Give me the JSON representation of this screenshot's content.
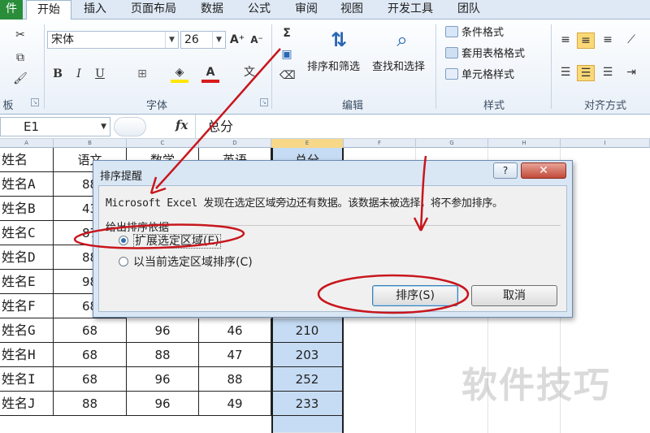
{
  "tabs": {
    "file": "件",
    "home": "开始",
    "insert": "插入",
    "page_layout": "页面布局",
    "data": "数据",
    "formulas": "公式",
    "review": "审阅",
    "view": "视图",
    "developer": "开发工具",
    "team": "团队"
  },
  "ribbon": {
    "clipboard_label": "板",
    "font_label": "字体",
    "font_name": "宋体",
    "font_size": "26",
    "edit_label": "编辑",
    "sort_filter": "排序和筛选",
    "find_select": "查找和选择",
    "styles_label": "样式",
    "conditional_format": "条件格式",
    "table_format": "套用表格格式",
    "cell_styles": "单元格样式",
    "align_label": "对齐方式"
  },
  "formula_bar": {
    "name_box": "E1",
    "fx": "fx",
    "content": "总分"
  },
  "sheet": {
    "columns": [
      "A",
      "B",
      "C",
      "D",
      "E",
      "F",
      "G",
      "H",
      "I"
    ],
    "header": [
      "姓名",
      "语文",
      "数学",
      "英语",
      "总分"
    ],
    "rows": [
      {
        "name": "姓名A",
        "b": "88",
        "c": "",
        "d": "",
        "e": ""
      },
      {
        "name": "姓名B",
        "b": "43",
        "c": "",
        "d": "",
        "e": ""
      },
      {
        "name": "姓名C",
        "b": "87",
        "c": "",
        "d": "",
        "e": ""
      },
      {
        "name": "姓名D",
        "b": "88",
        "c": "",
        "d": "",
        "e": ""
      },
      {
        "name": "姓名E",
        "b": "98",
        "c": "",
        "d": "",
        "e": ""
      },
      {
        "name": "姓名F",
        "b": "68",
        "c": "",
        "d": "",
        "e": ""
      },
      {
        "name": "姓名G",
        "b": "68",
        "c": "96",
        "d": "46",
        "e": "210"
      },
      {
        "name": "姓名H",
        "b": "68",
        "c": "88",
        "d": "47",
        "e": "203"
      },
      {
        "name": "姓名I",
        "b": "68",
        "c": "96",
        "d": "88",
        "e": "252"
      },
      {
        "name": "姓名J",
        "b": "88",
        "c": "96",
        "d": "49",
        "e": "233"
      }
    ]
  },
  "dialog": {
    "title": "排序提醒",
    "help": "?",
    "close": "✕",
    "message": "Microsoft Excel 发现在选定区域旁边还有数据。该数据未被选择，将不参加排序。",
    "group_label": "给出排序依据",
    "option_expand": "扩展选定区域(E)",
    "option_current": "以当前选定区域排序(C)",
    "sort_button": "排序(S)",
    "cancel_button": "取消"
  },
  "watermark": "软件技巧",
  "colors": {
    "file_tab": "#2a8d3a",
    "selection_fill": "#c6dcf4",
    "annotation_red": "#c8161d",
    "close_button": "#c24a38"
  }
}
